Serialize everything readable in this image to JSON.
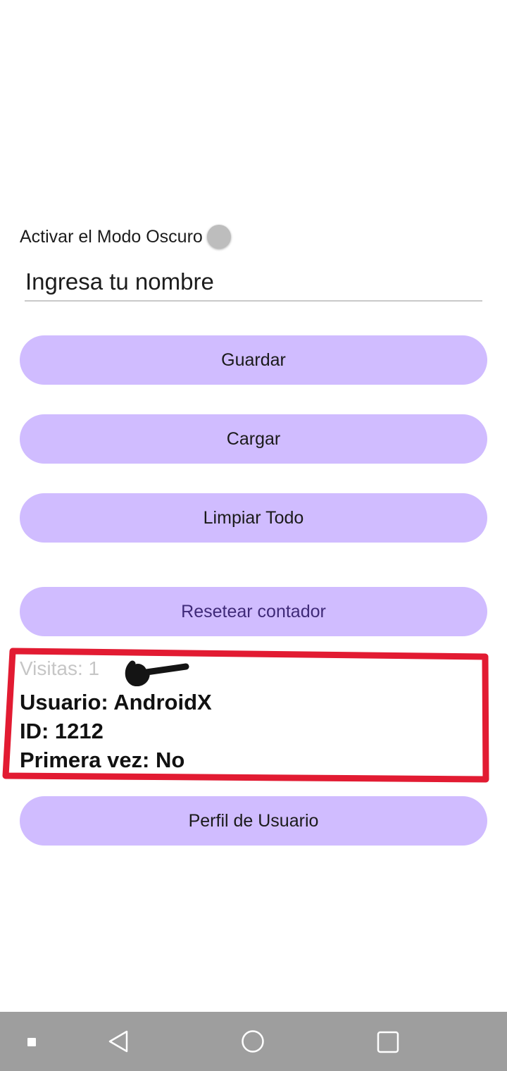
{
  "settings": {
    "dark_mode_label": "Activar el Modo Oscuro",
    "dark_mode_enabled": false
  },
  "name_field": {
    "placeholder": "Ingresa tu nombre",
    "value": ""
  },
  "buttons": {
    "save": "Guardar",
    "load": "Cargar",
    "clear": "Limpiar Todo",
    "reset_counter": "Resetear contador",
    "profile": "Perfil de Usuario"
  },
  "stats": {
    "visits": "Visitas: 1",
    "user": "Usuario: AndroidX",
    "id": "ID: 1212",
    "first_time": "Primera vez: No"
  },
  "colors": {
    "button_bg": "#d0bcff",
    "accent_text": "#3f2a78",
    "annotation_red": "#e21b32",
    "nav_bar": "#9e9e9e"
  },
  "nav_bar": {
    "icons": [
      "recents-square-icon",
      "back-triangle-icon",
      "home-circle-icon",
      "overview-square-icon"
    ]
  }
}
